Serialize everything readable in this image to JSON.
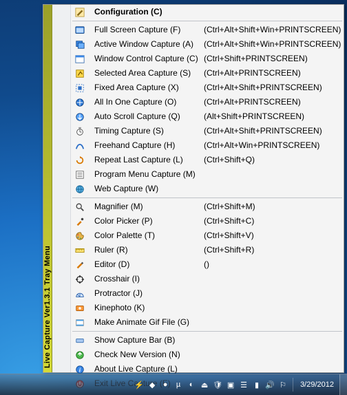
{
  "stripe_title": "Live Capture Ver1.3.1 Tray Menu",
  "clock": "3/29/2012",
  "groups": [
    {
      "items": [
        {
          "id": "configuration",
          "label": "Configuration (C)",
          "shortcut": "",
          "icon": "configuration-icon",
          "bold": true
        }
      ]
    },
    {
      "items": [
        {
          "id": "full-screen-capture",
          "label": "Full Screen Capture (F)",
          "shortcut": "(Ctrl+Alt+Shift+Win+PRINTSCREEN)",
          "icon": "fullscreen-icon"
        },
        {
          "id": "active-window-capture",
          "label": "Active Window Capture (A)",
          "shortcut": "(Ctrl+Alt+Shift+Win+PRINTSCREEN)",
          "icon": "active-window-icon"
        },
        {
          "id": "window-control-capture",
          "label": "Window Control Capture (C)",
          "shortcut": "(Ctrl+Shift+PRINTSCREEN)",
          "icon": "window-control-icon"
        },
        {
          "id": "selected-area-capture",
          "label": "Selected Area Capture (S)",
          "shortcut": "(Ctrl+Alt+PRINTSCREEN)",
          "icon": "selected-area-icon"
        },
        {
          "id": "fixed-area-capture",
          "label": "Fixed Area Capture (X)",
          "shortcut": "(Ctrl+Alt+Shift+PRINTSCREEN)",
          "icon": "fixed-area-icon"
        },
        {
          "id": "all-in-one-capture",
          "label": "All In One Capture (O)",
          "shortcut": "(Ctrl+Alt+PRINTSCREEN)",
          "icon": "allinone-icon"
        },
        {
          "id": "auto-scroll-capture",
          "label": "Auto Scroll Capture (Q)",
          "shortcut": "(Alt+Shift+PRINTSCREEN)",
          "icon": "autoscroll-icon"
        },
        {
          "id": "timing-capture",
          "label": "Timing Capture (S)",
          "shortcut": "(Ctrl+Alt+Shift+PRINTSCREEN)",
          "icon": "timing-icon"
        },
        {
          "id": "freehand-capture",
          "label": "Freehand Capture (H)",
          "shortcut": "(Ctrl+Alt+Win+PRINTSCREEN)",
          "icon": "freehand-icon"
        },
        {
          "id": "repeat-last-capture",
          "label": "Repeat Last Capture (L)",
          "shortcut": "(Ctrl+Shift+Q)",
          "icon": "repeat-icon"
        },
        {
          "id": "program-menu-capture",
          "label": "Program Menu Capture (M)",
          "shortcut": "",
          "icon": "program-menu-icon"
        },
        {
          "id": "web-capture",
          "label": "Web Capture (W)",
          "shortcut": "",
          "icon": "web-icon"
        }
      ]
    },
    {
      "items": [
        {
          "id": "magnifier",
          "label": "Magnifier (M)",
          "shortcut": "(Ctrl+Shift+M)",
          "icon": "magnifier-icon"
        },
        {
          "id": "color-picker",
          "label": "Color Picker (P)",
          "shortcut": "(Ctrl+Shift+C)",
          "icon": "color-picker-icon"
        },
        {
          "id": "color-palette",
          "label": "Color Palette (T)",
          "shortcut": "(Ctrl+Shift+V)",
          "icon": "color-palette-icon"
        },
        {
          "id": "ruler",
          "label": "Ruler (R)",
          "shortcut": "(Ctrl+Shift+R)",
          "icon": "ruler-icon"
        },
        {
          "id": "editor",
          "label": "Editor (D)",
          "shortcut": "()",
          "icon": "editor-icon"
        },
        {
          "id": "crosshair",
          "label": "Crosshair (I)",
          "shortcut": "",
          "icon": "crosshair-icon"
        },
        {
          "id": "protractor",
          "label": "Protractor (J)",
          "shortcut": "",
          "icon": "protractor-icon"
        },
        {
          "id": "kinephoto",
          "label": "Kinephoto (K)",
          "shortcut": "",
          "icon": "kinephoto-icon"
        },
        {
          "id": "make-animate-gif",
          "label": "Make Animate Gif File (G)",
          "shortcut": "",
          "icon": "gif-icon"
        }
      ]
    },
    {
      "items": [
        {
          "id": "show-capture-bar",
          "label": "Show Capture Bar (B)",
          "shortcut": "",
          "icon": "capturebar-icon"
        },
        {
          "id": "check-new-version",
          "label": "Check New Version (N)",
          "shortcut": "",
          "icon": "update-icon"
        },
        {
          "id": "about",
          "label": "About Live Capture (L)",
          "shortcut": "",
          "icon": "about-icon"
        },
        {
          "id": "exit",
          "label": "Exit Live Capture (E)",
          "shortcut": "",
          "icon": "exit-icon"
        }
      ]
    }
  ],
  "tray_icons": [
    "tray-battery-icon",
    "tray-app1-icon",
    "tray-app2-icon",
    "tray-utorrent-icon",
    "tray-app3-icon",
    "tray-safeeject-icon",
    "tray-shield-icon",
    "tray-app4-icon",
    "tray-app5-icon",
    "tray-network-icon",
    "tray-volume-icon",
    "tray-flag-icon"
  ]
}
